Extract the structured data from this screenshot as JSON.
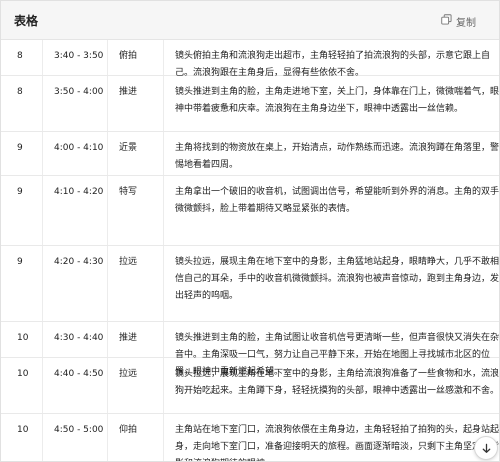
{
  "header": {
    "title": "表格",
    "copy_label": "复制"
  },
  "rows": [
    {
      "id": "8",
      "time": "3:40 - 3:50",
      "shot": "俯拍",
      "desc": "镜头俯拍主角和流浪狗走出超市，主角轻轻拍了拍流浪狗的头部，示意它跟上自己。流浪狗跟在主角身后，显得有些依依不舍。"
    },
    {
      "id": "8",
      "time": "3:50 - 4:00",
      "shot": "推进",
      "desc": "镜头推进到主角的脸，主角走进地下室，关上门，身体靠在门上，微微喘着气，眼神中带着疲惫和庆幸。流浪狗在主角身边坐下，眼神中透露出一丝信赖。"
    },
    {
      "id": "9",
      "time": "4:00 - 4:10",
      "shot": "近景",
      "desc": "主角将找到的物资放在桌上，开始清点，动作熟练而迅速。流浪狗蹲在角落里，警惕地看着四周。"
    },
    {
      "id": "9",
      "time": "4:10 - 4:20",
      "shot": "特写",
      "desc": "主角拿出一个破旧的收音机，试图调出信号，希望能听到外界的消息。主角的双手微微颤抖，脸上带着期待又略显紧张的表情。"
    },
    {
      "id": "9",
      "time": "4:20 - 4:30",
      "shot": "拉远",
      "desc": "镜头拉远，展现主角在地下室中的身影，主角猛地站起身，眼睛睁大，几乎不敢相信自己的耳朵，手中的收音机微微颤抖。流浪狗也被声音惊动，跑到主角身边，发出轻声的呜咽。"
    },
    {
      "id": "10",
      "time": "4:30 - 4:40",
      "shot": "推进",
      "desc": "镜头推进到主角的脸，主角试图让收音机信号更清晰一些，但声音很快又消失在杂音中。主角深吸一口气，努力让自己平静下来，开始在地图上寻找城市北区的位置，眼神中重新燃起希望。"
    },
    {
      "id": "10",
      "time": "4:40 - 4:50",
      "shot": "拉远",
      "desc": "镜头拉远，展现主角在地下室中的身影，主角给流浪狗准备了一些食物和水，流浪狗开始吃起来。主角蹲下身，轻轻抚摸狗的头部，眼神中透露出一丝感激和不舍。"
    },
    {
      "id": "10",
      "time": "4:50 - 5:00",
      "shot": "仰拍",
      "desc": "主角站在地下室门口，流浪狗依偎在主角身边，主角轻轻拍了拍狗的头，起身站起身，走向地下室门口，准备迎接明天的旅程。画面逐渐暗淡，只剩下主角坚定的背影和流浪狗期待的眼神。"
    }
  ]
}
